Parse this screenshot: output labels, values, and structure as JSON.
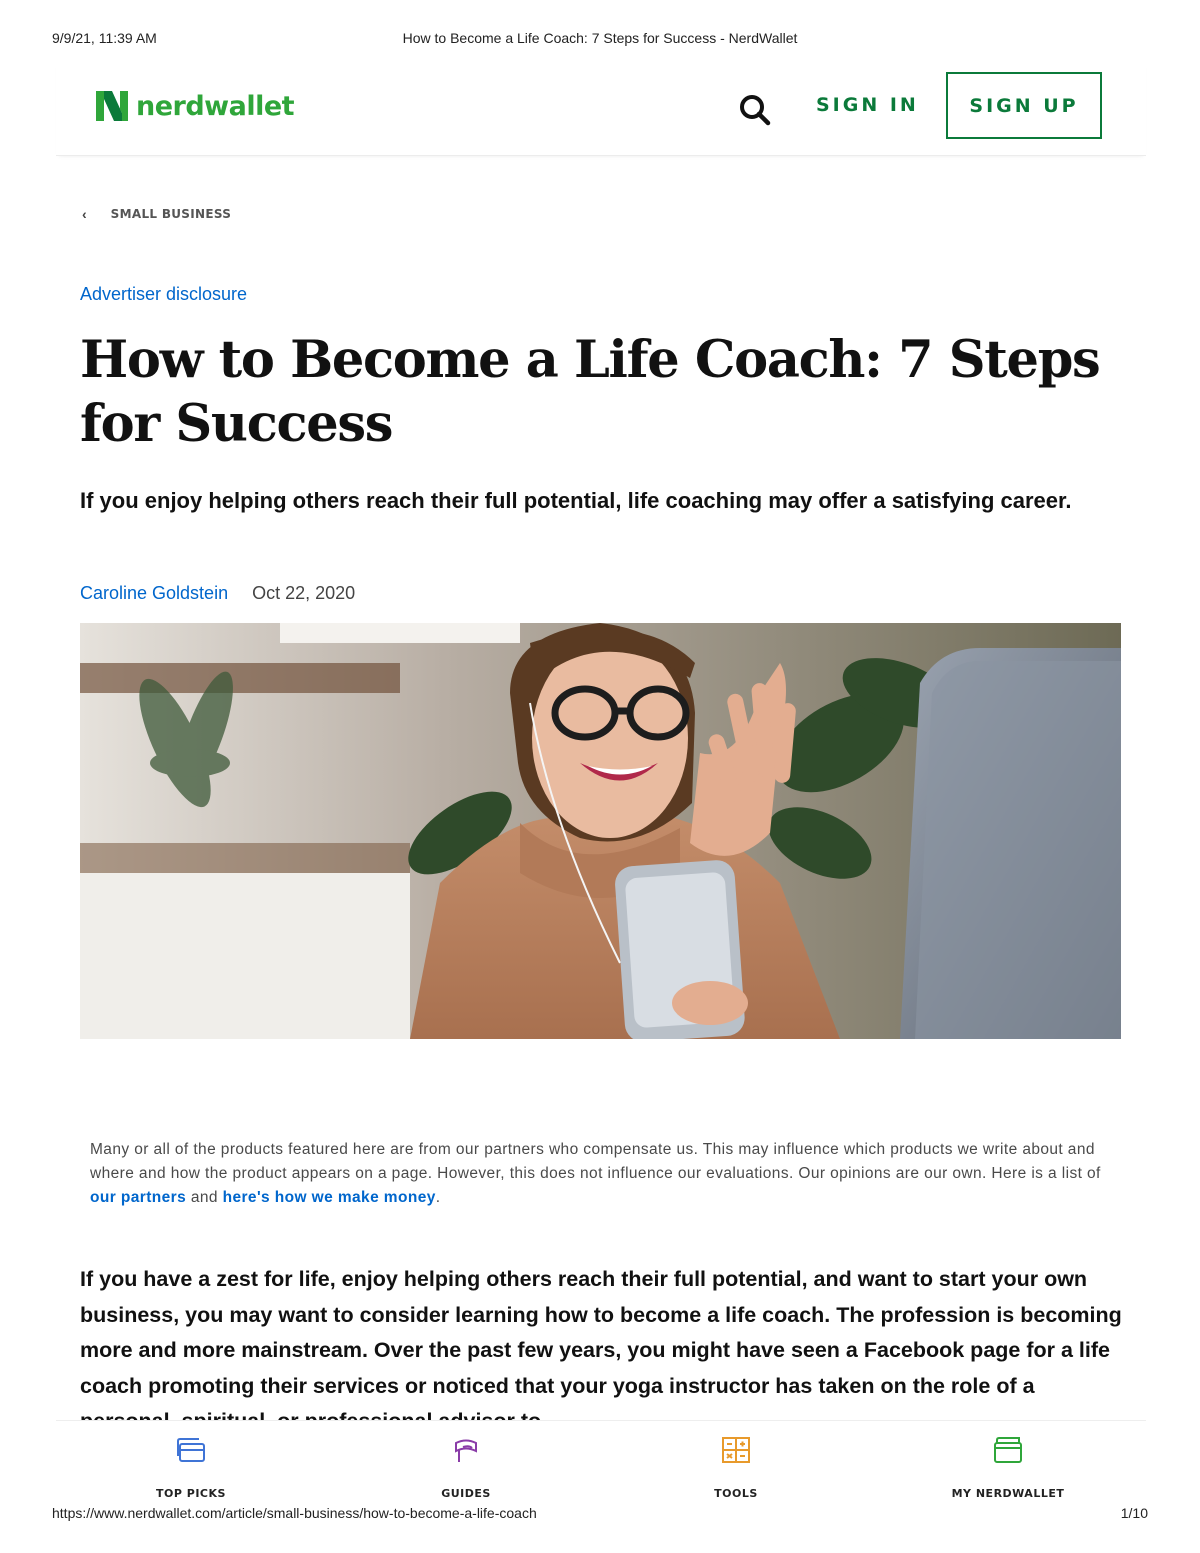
{
  "print_header": {
    "datetime": "9/9/21, 11:39 AM",
    "title": "How to Become a Life Coach: 7 Steps for Success - NerdWallet"
  },
  "header": {
    "logo_text": "nerdwallet",
    "sign_in_label": "SIGN IN",
    "sign_up_label": "SIGN UP"
  },
  "breadcrumb": {
    "label": "SMALL BUSINESS"
  },
  "article": {
    "disclosure_link": "Advertiser disclosure",
    "title": "How to Become a Life Coach: 7 Steps for Success",
    "dek": "If you enjoy helping others reach their full potential, life coaching may offer a satisfying career.",
    "author": "Caroline Goldstein",
    "date": "Oct 22, 2020",
    "legal_text": "Many or all of the products featured here are from our partners who compensate us. This may influence which products we write about and where and how the product appears on a page. However, this does not influence our evaluations. Our opinions are our own. Here is a list of",
    "legal_link_partners": "our partners",
    "legal_and": "and",
    "legal_link_money": "here's how we make money",
    "legal_end": ".",
    "body": "If you have a zest for life, enjoy helping others reach their full potential, and want to start your own business, you may want to consider learning how to become a life coach. The profession is becoming more and more mainstream. Over the past few years, you might have seen a Facebook page for a life coach promoting their services or noticed that your yoga instructor has taken on the role of a personal, spiritual, or professional advisor to"
  },
  "bottom_nav": [
    {
      "label": "TOP PICKS",
      "icon": "cards-icon"
    },
    {
      "label": "GUIDES",
      "icon": "graduation-cap-icon"
    },
    {
      "label": "TOOLS",
      "icon": "calculator-icon"
    },
    {
      "label": "MY NERDWALLET",
      "icon": "wallet-icon"
    }
  ],
  "print_footer": {
    "url": "https://www.nerdwallet.com/article/small-business/how-to-become-a-life-coach",
    "page": "1/10"
  },
  "colors": {
    "brand_green": "#0b7a3a",
    "logo_green": "#2fa63a",
    "link_blue": "#0066cc",
    "nav_blue": "#3f74d6",
    "nav_purple": "#8a3ca8",
    "nav_orange": "#e89a2b",
    "nav_green": "#2fa63a"
  }
}
